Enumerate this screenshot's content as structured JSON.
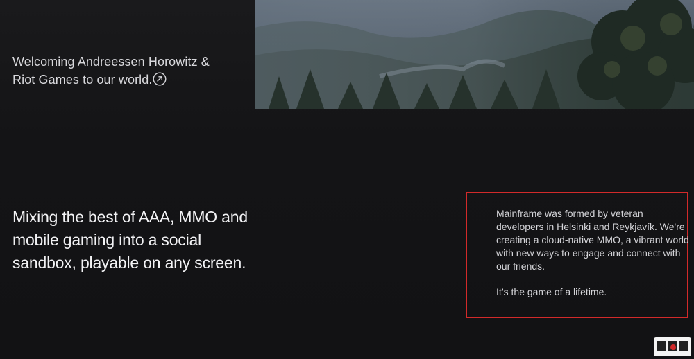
{
  "hero": {
    "image_desc": "forest-landscape"
  },
  "welcome": {
    "text": "Welcoming Andreessen Horowitz & Riot Games to our world.",
    "icon": "arrow-up-right-circle-icon"
  },
  "tagline": {
    "text": "Mixing the best of AAA, MMO and mobile gaming into a social sandbox, playable on any screen."
  },
  "about": {
    "paragraph1": "Mainframe was formed by veteran developers in Helsinki and Reykjavík. We're creating a cloud-native MMO, a vibrant world with new ways to engage and connect with our friends.",
    "paragraph2": "It’s the game of a lifetime."
  },
  "watermark": {
    "text": "电玩迷"
  },
  "colors": {
    "background": "#141416",
    "highlight_border": "#d22a2a",
    "text_primary": "#f2f2f4",
    "text_secondary": "#d4d4d8"
  }
}
